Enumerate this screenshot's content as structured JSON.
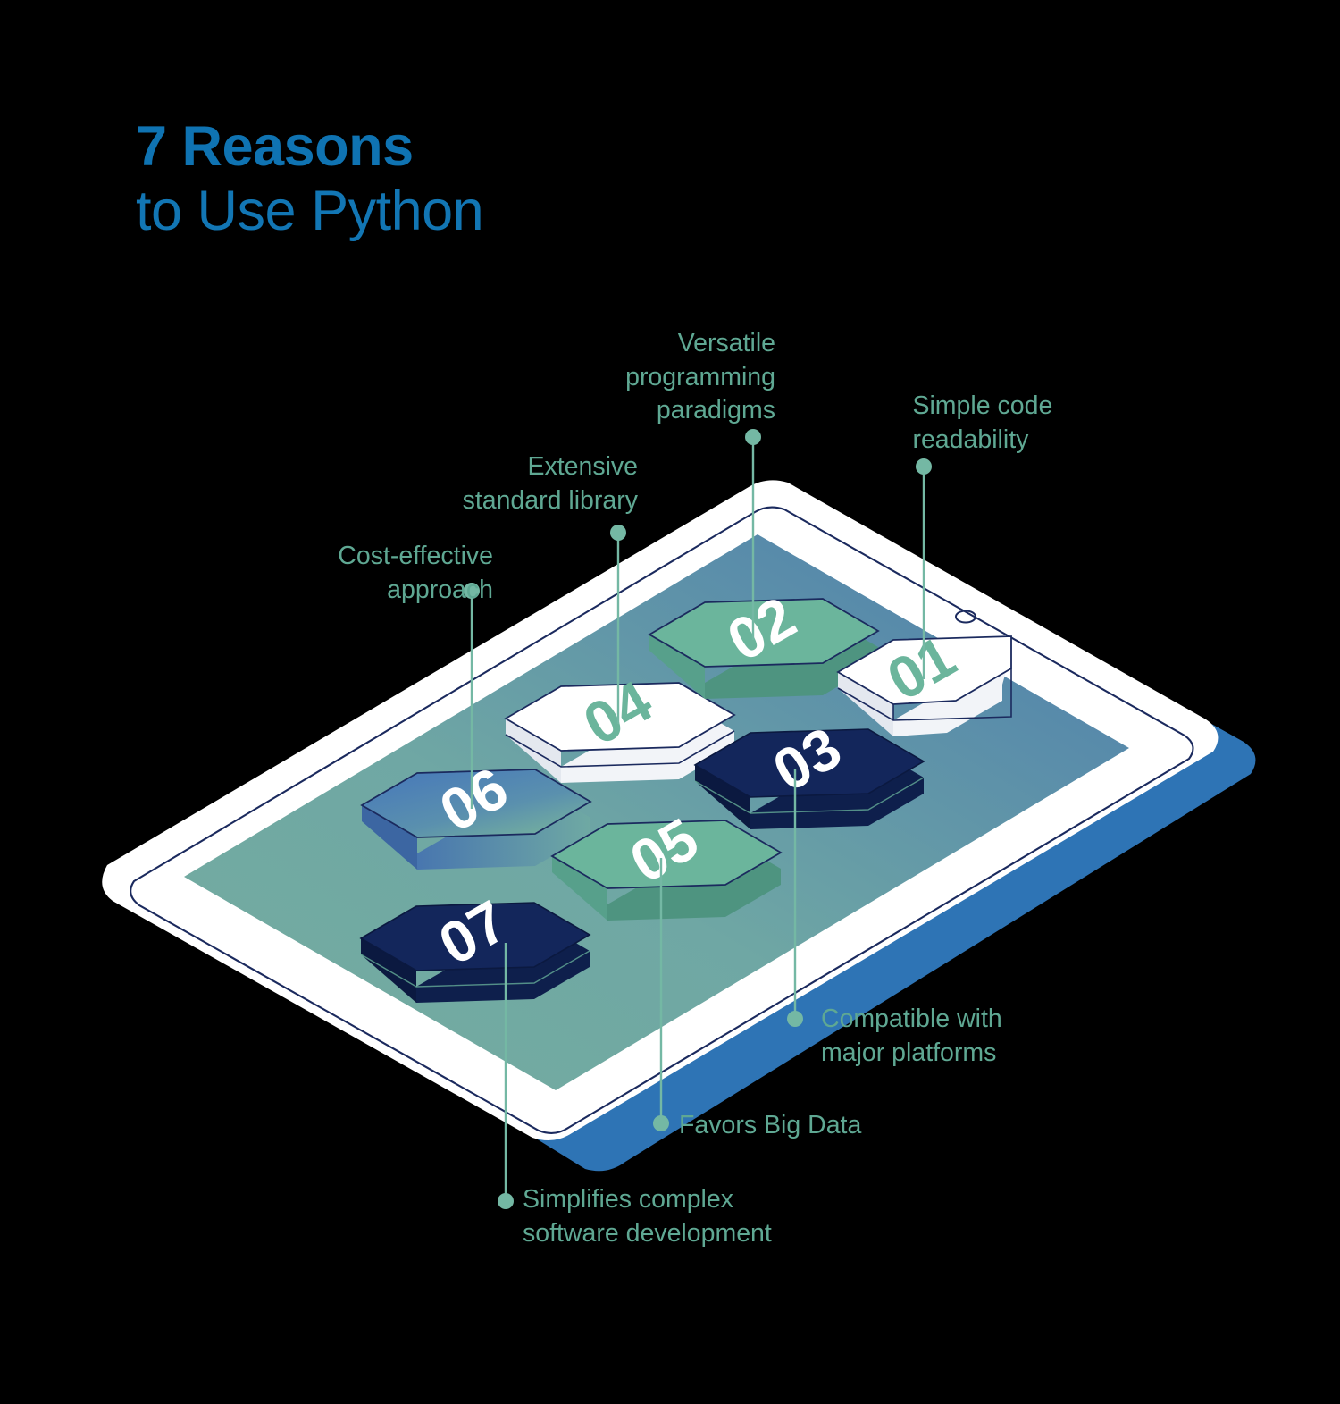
{
  "title": {
    "line1": "7 Reasons",
    "line2": "to Use Python",
    "color": "#1276B4"
  },
  "theme": {
    "background": "#000000",
    "label_color": "#5FA893",
    "connector_color": "#74B8A4",
    "green_hex": "#6BB59C",
    "navy_hex": "#13265B",
    "blue_hex": "#4E7FB5",
    "white_hex": "#FFFFFF",
    "tablet_body": "#FFFFFF",
    "tablet_shadow": "#2E74B5",
    "screen_left": "#6FA99E",
    "screen_right": "#4C7CAE",
    "outline": "#1B2A5E"
  },
  "device": {
    "name": "tablet",
    "camera_dot": "camera-dot"
  },
  "reasons": [
    {
      "number": "01",
      "label": "Simple code\nreadability",
      "style": "white",
      "number_color": "#6BB59C",
      "align": "left"
    },
    {
      "number": "02",
      "label": "Versatile\nprogramming\nparadigms",
      "style": "green",
      "number_color": "#FFFFFF",
      "align": "right"
    },
    {
      "number": "03",
      "label": "Compatible with\nmajor platforms",
      "style": "navy",
      "number_color": "#FFFFFF",
      "align": "left"
    },
    {
      "number": "04",
      "label": "Extensive\nstandard library",
      "style": "white",
      "number_color": "#6BB59C",
      "align": "right"
    },
    {
      "number": "05",
      "label": "Favors Big Data",
      "style": "green",
      "number_color": "#FFFFFF",
      "align": "left"
    },
    {
      "number": "06",
      "label": "Cost-effective\napproach",
      "style": "blue",
      "number_color": "#FFFFFF",
      "align": "right"
    },
    {
      "number": "07",
      "label": "Simplifies complex\nsoftware development",
      "style": "navy",
      "number_color": "#FFFFFF",
      "align": "left"
    }
  ]
}
